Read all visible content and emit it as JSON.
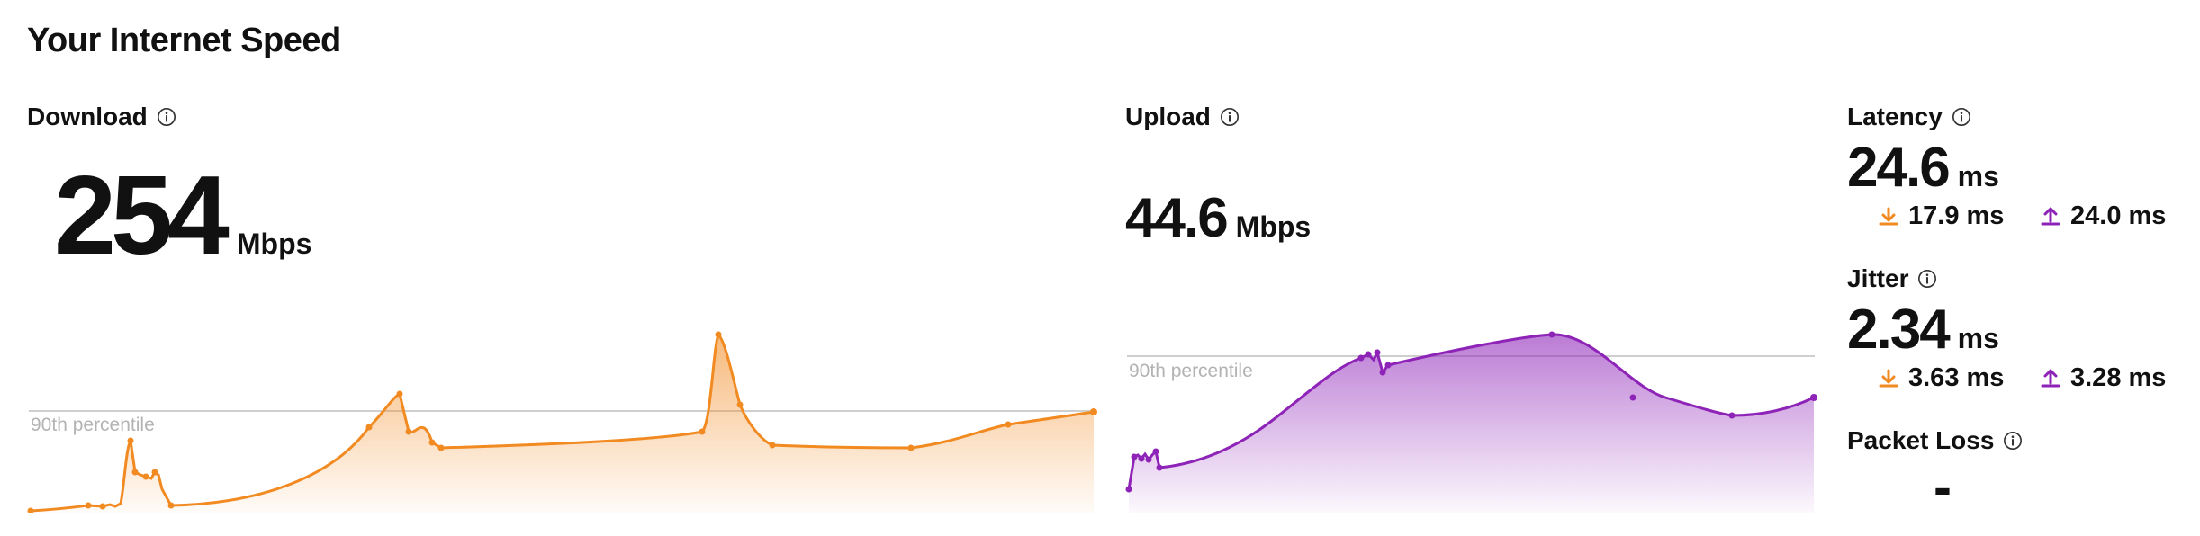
{
  "header": {
    "title": "Your Internet Speed"
  },
  "download": {
    "label": "Download",
    "value": "254",
    "unit": "Mbps",
    "percentile_label": "90th percentile",
    "color": "#f28a22"
  },
  "upload": {
    "label": "Upload",
    "value": "44.6",
    "unit": "Mbps",
    "percentile_label": "90th percentile",
    "color": "#8e23b8"
  },
  "latency": {
    "label": "Latency",
    "value": "24.6",
    "unit": "ms",
    "download_value": "17.9 ms",
    "upload_value": "24.0 ms"
  },
  "jitter": {
    "label": "Jitter",
    "value": "2.34",
    "unit": "ms",
    "download_value": "3.63 ms",
    "upload_value": "3.28 ms"
  },
  "packet_loss": {
    "label": "Packet Loss",
    "value": "-"
  },
  "icons": {
    "info": "info-circle-icon",
    "download": "download-arrow-icon",
    "upload": "upload-arrow-icon"
  }
}
